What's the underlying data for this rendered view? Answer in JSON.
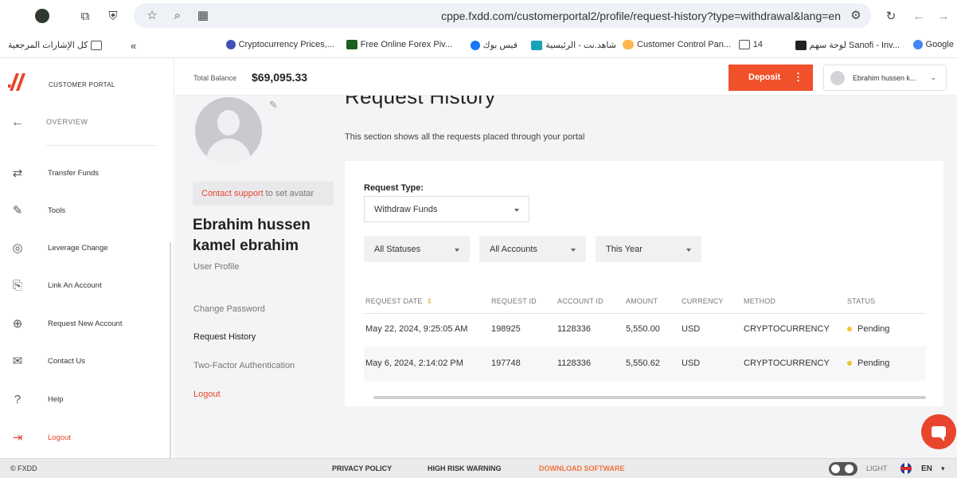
{
  "browser": {
    "url": "cppe.fxdd.com/customerportal2/profile/request-history?type=withdrawal&lang=en",
    "bookmarks": [
      {
        "label": "Google",
        "icon": "google-icon"
      },
      {
        "label": "لوحة سهم Sanofi - Inv...",
        "icon": "inv-icon"
      },
      {
        "label": "14",
        "icon": "folder-icon"
      },
      {
        "label": "Customer Control Pan...",
        "icon": "cloud-icon"
      },
      {
        "label": "شاهد.نت - الرئيسية",
        "icon": "shahid-icon"
      },
      {
        "label": "فيس بوك",
        "icon": "facebook-icon"
      },
      {
        "label": "Free Online Forex Piv...",
        "icon": "x-icon"
      },
      {
        "label": "Cryptocurrency Prices,...",
        "icon": "crypto-icon"
      }
    ],
    "all_bookmarks": "كل الإشارات المرجعية"
  },
  "sidebar": {
    "portal_label": "CUSTOMER PORTAL",
    "overview": "OVERVIEW",
    "items": [
      {
        "label": "Transfer Funds",
        "icon": "transfer-icon"
      },
      {
        "label": "Tools",
        "icon": "edit-icon"
      },
      {
        "label": "Leverage Change",
        "icon": "target-icon"
      },
      {
        "label": "Link An Account",
        "icon": "link-account-icon"
      },
      {
        "label": "Request New Account",
        "icon": "add-account-icon"
      },
      {
        "label": "Contact Us",
        "icon": "mail-icon"
      },
      {
        "label": "Help",
        "icon": "help-icon"
      },
      {
        "label": "Logout",
        "icon": "logout-icon"
      }
    ]
  },
  "topbar": {
    "balance_label": "Total Balance",
    "balance_value": "$69,095.33",
    "deposit_label": "Deposit",
    "user_name": "Ebrahim hussen k..."
  },
  "profile": {
    "contact_link": "Contact support",
    "contact_rest": "to set avatar",
    "name": "Ebrahim hussen kamel ebrahim",
    "sub": "User Profile",
    "nav": [
      "Change Password",
      "Request History",
      "Two-Factor Authentication",
      "Logout"
    ]
  },
  "page": {
    "title": "Request History",
    "description": "This section shows all the requests placed through your portal"
  },
  "filters": {
    "request_type_label": "Request Type:",
    "request_type_value": "Withdraw Funds",
    "status": "All Statuses",
    "accounts": "All Accounts",
    "period": "This Year"
  },
  "table": {
    "columns": [
      "REQUEST DATE",
      "REQUEST ID",
      "ACCOUNT ID",
      "AMOUNT",
      "CURRENCY",
      "METHOD",
      "STATUS"
    ],
    "rows": [
      {
        "date": "May 22, 2024, 9:25:05 AM",
        "request_id": "198925",
        "account_id": "1128336",
        "amount": "5,550.00",
        "currency": "USD",
        "method": "CRYPTOCURRENCY",
        "status": "Pending"
      },
      {
        "date": "May 6, 2024, 2:14:02 PM",
        "request_id": "197748",
        "account_id": "1128336",
        "amount": "5,550.62",
        "currency": "USD",
        "method": "CRYPTOCURRENCY",
        "status": "Pending"
      }
    ]
  },
  "footer": {
    "copyright": "© FXDD",
    "privacy": "PRIVACY POLICY",
    "risk": "HIGH RISK WARNING",
    "download": "DOWNLOAD SOFTWARE",
    "theme": "LIGHT",
    "language": "EN"
  },
  "colors": {
    "accent": "#f0502a",
    "status_pending": "#f2c233"
  }
}
